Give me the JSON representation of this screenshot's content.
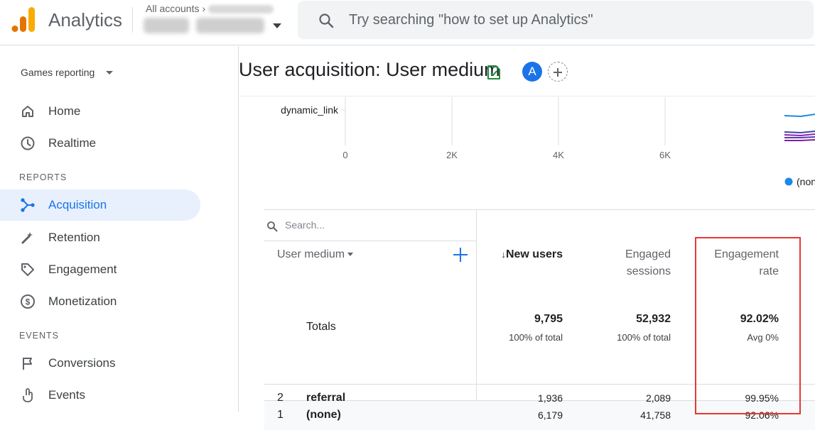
{
  "header": {
    "app_title": "Analytics",
    "breadcrumb_all_accounts": "All accounts",
    "search_placeholder": "Try searching \"how to set up Analytics\""
  },
  "sidebar": {
    "collection": "Games reporting",
    "items_top": [
      {
        "label": "Home",
        "icon": "home-icon"
      },
      {
        "label": "Realtime",
        "icon": "clock-icon"
      }
    ],
    "section_reports": "REPORTS",
    "items_reports": [
      {
        "label": "Acquisition",
        "icon": "acquisition-icon",
        "active": true
      },
      {
        "label": "Retention",
        "icon": "retention-icon"
      },
      {
        "label": "Engagement",
        "icon": "tag-icon"
      },
      {
        "label": "Monetization",
        "icon": "dollar-icon"
      }
    ],
    "section_events": "EVENTS",
    "items_events": [
      {
        "label": "Conversions",
        "icon": "flag-icon"
      },
      {
        "label": "Events",
        "icon": "touch-icon"
      }
    ]
  },
  "page": {
    "title": "User acquisition: User medium",
    "avatar_letter": "A"
  },
  "chart_data": {
    "type": "bar",
    "categories": [
      "dynamic_link"
    ],
    "x_ticks": [
      "0",
      "2K",
      "4K",
      "6K"
    ],
    "xlim": [
      0,
      8000
    ],
    "legend": [
      "(non"
    ],
    "grid": true,
    "accent_colors": [
      "#1e88e5",
      "#3949ab",
      "#8e24aa",
      "#5e35b1"
    ]
  },
  "table": {
    "search_placeholder": "Search...",
    "dimension_header": "User medium",
    "columns": [
      {
        "line1": "New users",
        "line2": "",
        "sorted": true
      },
      {
        "line1": "Engaged",
        "line2": "sessions"
      },
      {
        "line1": "Engagement",
        "line2": "rate"
      }
    ],
    "totals_label": "Totals",
    "totals": [
      {
        "value": "9,795",
        "sub": "100% of total"
      },
      {
        "value": "52,932",
        "sub": "100% of total"
      },
      {
        "value": "92.02%",
        "sub": "Avg 0%"
      }
    ],
    "rows": [
      {
        "index": "1",
        "dimension": "(none)",
        "values": [
          "6,179",
          "41,758",
          "92.06%"
        ]
      },
      {
        "index": "2",
        "dimension": "referral",
        "values": [
          "1,936",
          "2,089",
          "99.95%"
        ]
      }
    ]
  },
  "colors": {
    "accent": "#1a73e8",
    "highlight": "#e53935"
  }
}
